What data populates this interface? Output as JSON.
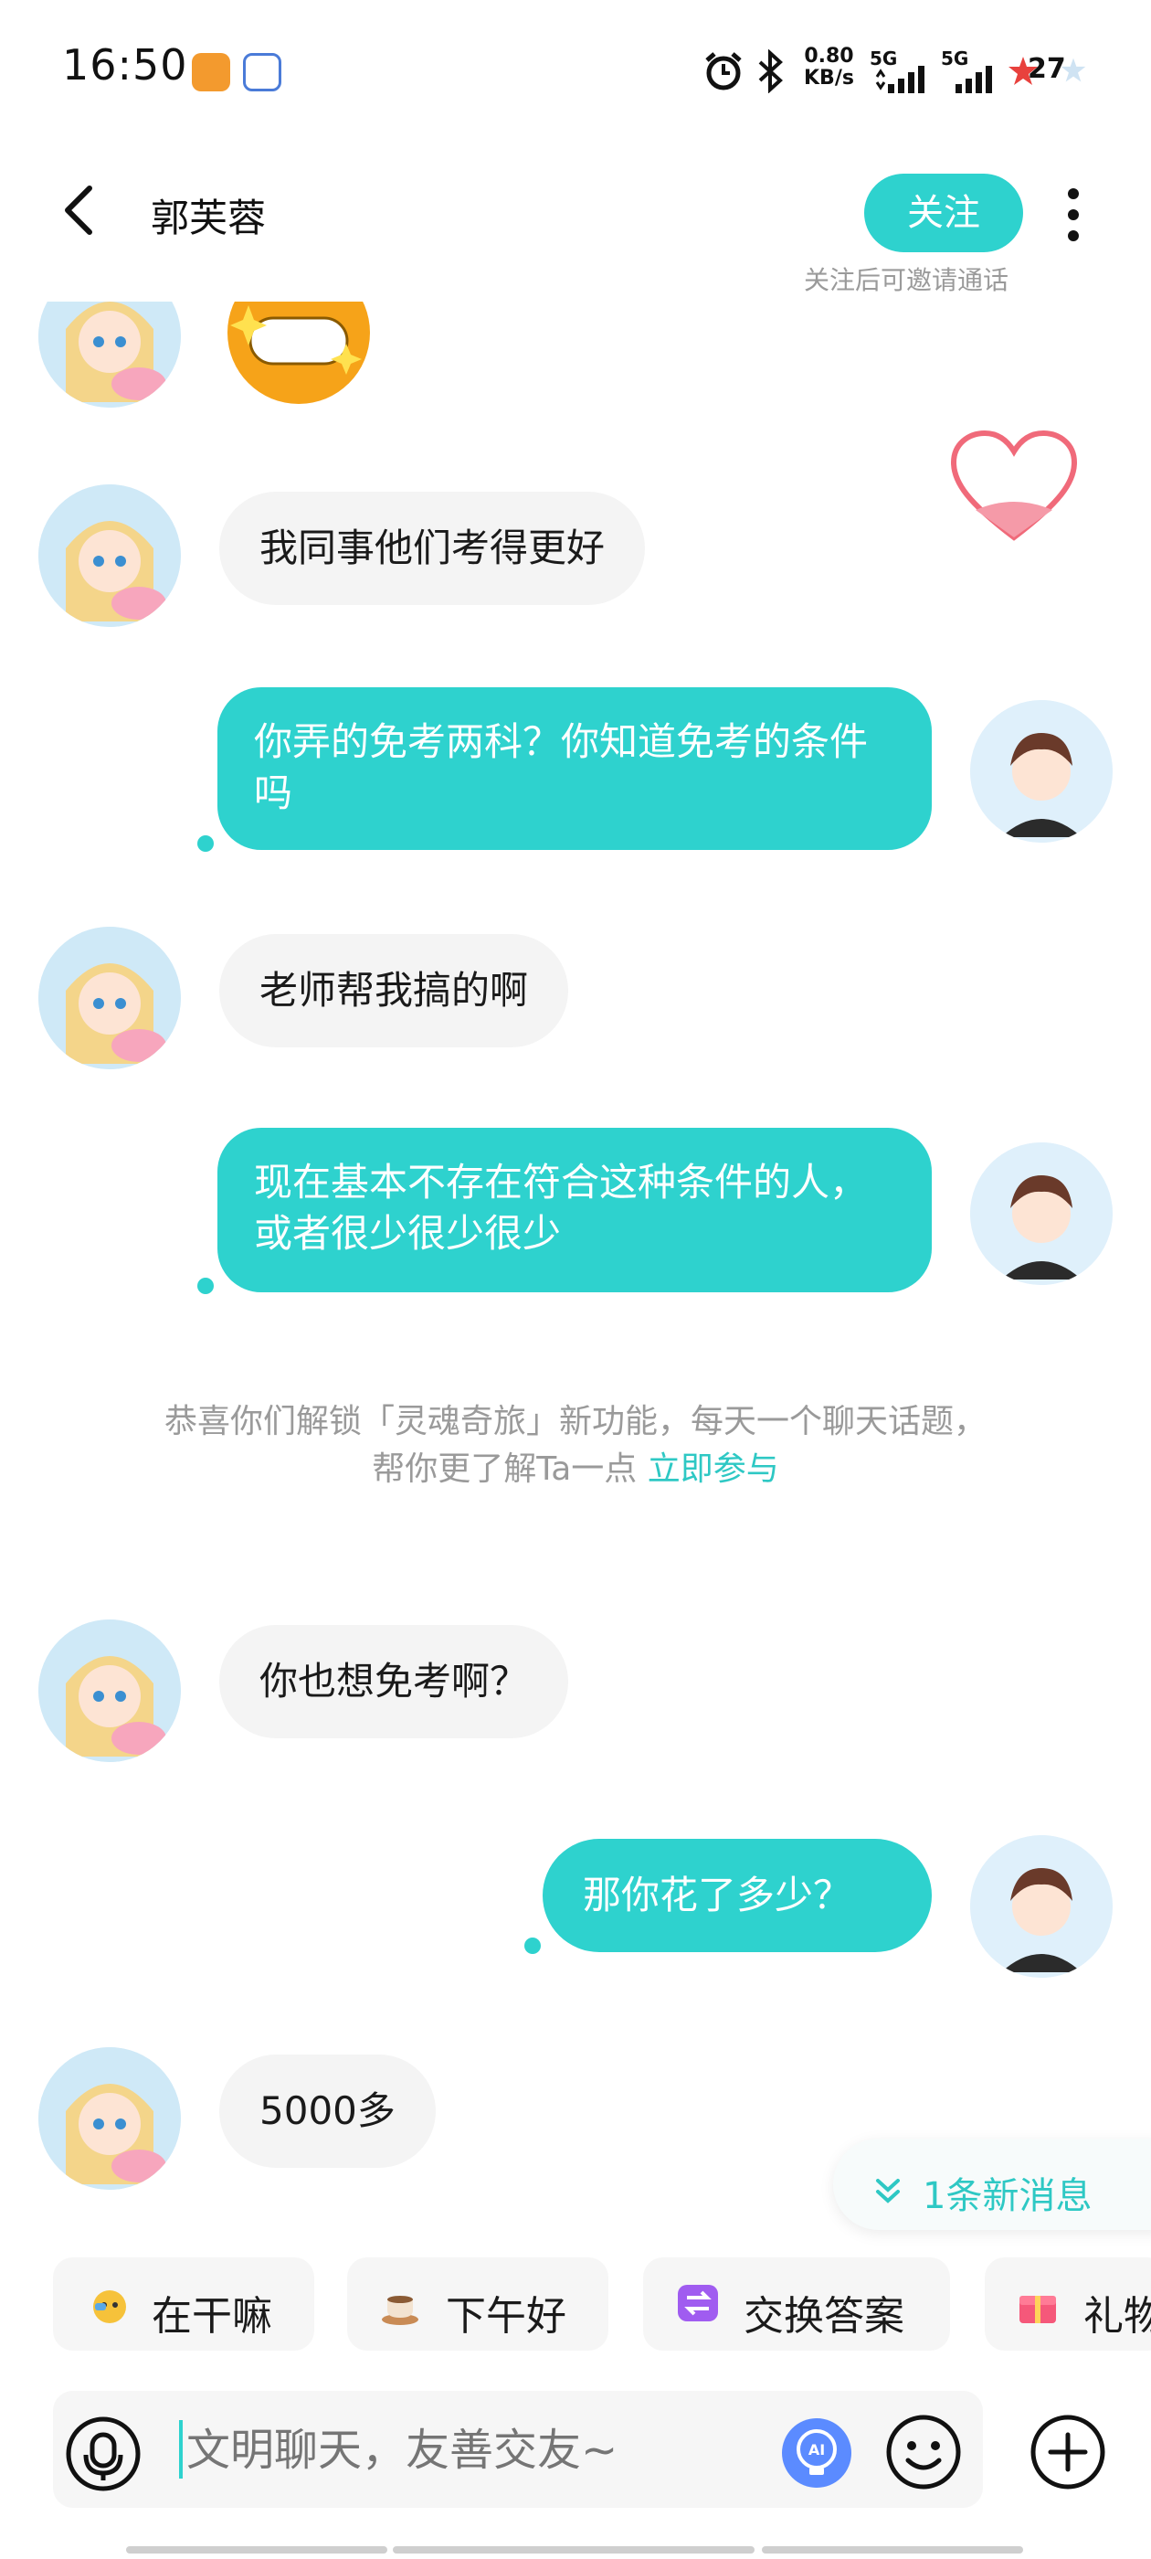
{
  "status_bar": {
    "time": "16:50",
    "net_speed_value": "0.80",
    "net_speed_unit": "KB/s",
    "signal1": "5G",
    "signal2": "5G",
    "battery": "27"
  },
  "header": {
    "title": "郭芙蓉",
    "follow_label": "关注",
    "follow_hint": "关注后可邀请通话"
  },
  "messages": [
    {
      "side": "in",
      "text": "我同事他们考得更好"
    },
    {
      "side": "out",
      "text": "你弄的免考两科？你知道免考的条件吗"
    },
    {
      "side": "in",
      "text": "老师帮我搞的啊"
    },
    {
      "side": "out",
      "text": "现在基本不存在符合这种条件的人，或者很少很少很少"
    },
    {
      "side": "in",
      "text": "你也想免考啊？"
    },
    {
      "side": "out",
      "text": "那你花了多少？"
    },
    {
      "side": "in",
      "text": "5000多"
    }
  ],
  "system_notice": {
    "line1": "恭喜你们解锁「灵魂奇旅」新功能，每天一个聊天话题，",
    "line2_prefix": "帮你更了解Ta一点",
    "link": "立即参与"
  },
  "new_message_badge": "1条新消息",
  "quick_replies": [
    {
      "label": "在干嘛",
      "icon": "emoji-icon"
    },
    {
      "label": "下午好",
      "icon": "coffee-icon"
    },
    {
      "label": "交换答案",
      "icon": "exchange-icon"
    },
    {
      "label": "礼物",
      "icon": "gift-icon"
    }
  ],
  "input": {
    "placeholder": "文明聊天，友善交友~"
  },
  "colors": {
    "accent": "#2ed2ce",
    "bubble_in": "#f4f4f4",
    "text_muted": "#9a9a9a"
  }
}
